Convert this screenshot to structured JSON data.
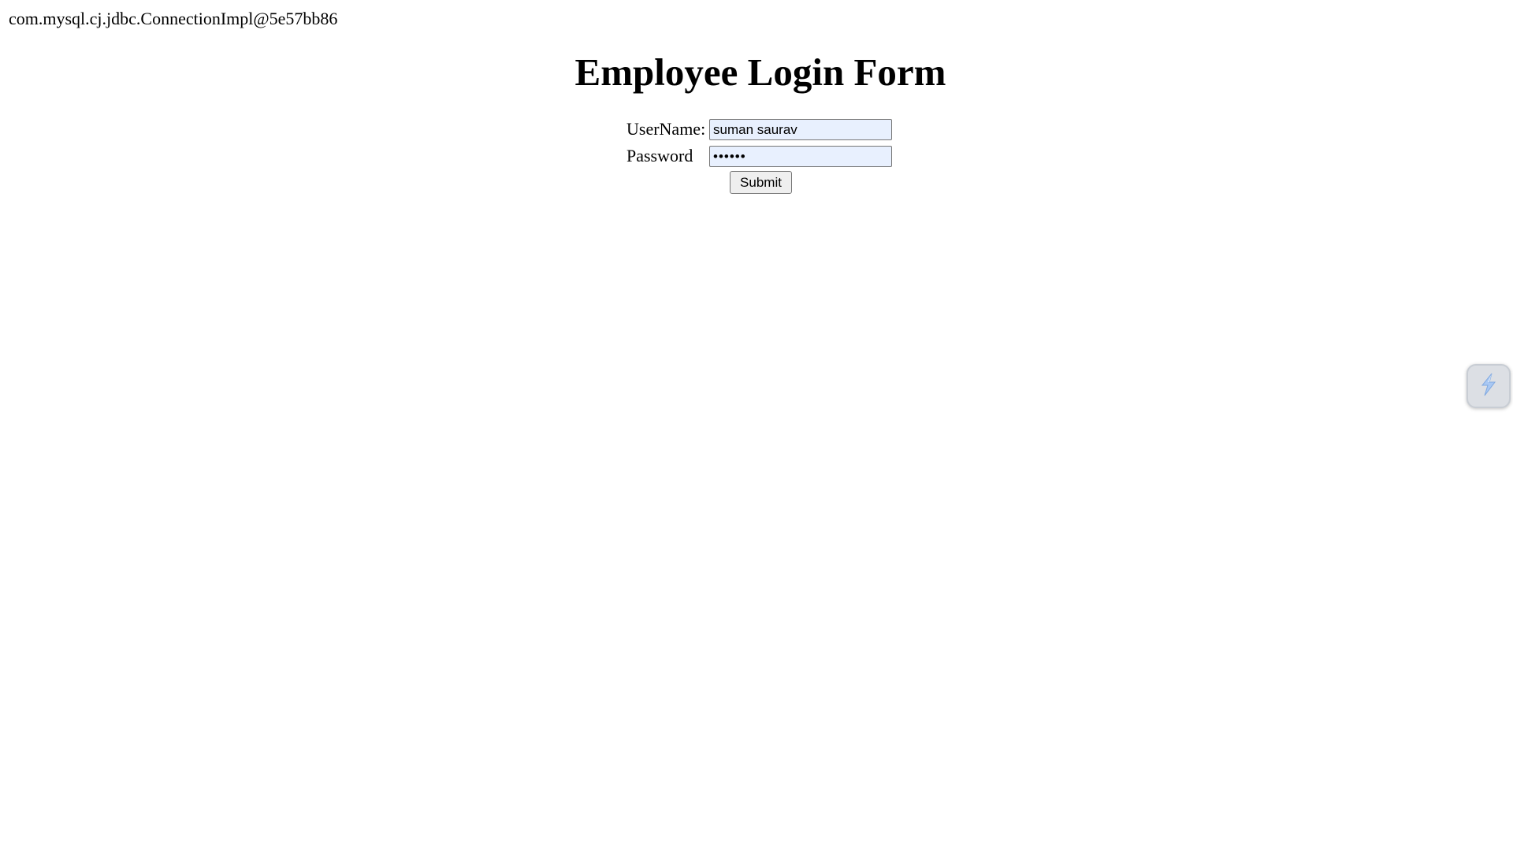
{
  "page": {
    "connection_text": "com.mysql.cj.jdbc.ConnectionImpl@5e57bb86",
    "title": "Employee Login Form"
  },
  "form": {
    "username_label": "UserName:",
    "username_value": "suman saurav",
    "password_label": "Password",
    "password_value": "••••••",
    "submit_label": "Submit"
  },
  "widget": {
    "icon": "lightning-bolt-icon"
  },
  "colors": {
    "autofill_background": "#e8f0fe",
    "widget_background": "#dcdfe4",
    "widget_icon": "#a9c8f3"
  }
}
